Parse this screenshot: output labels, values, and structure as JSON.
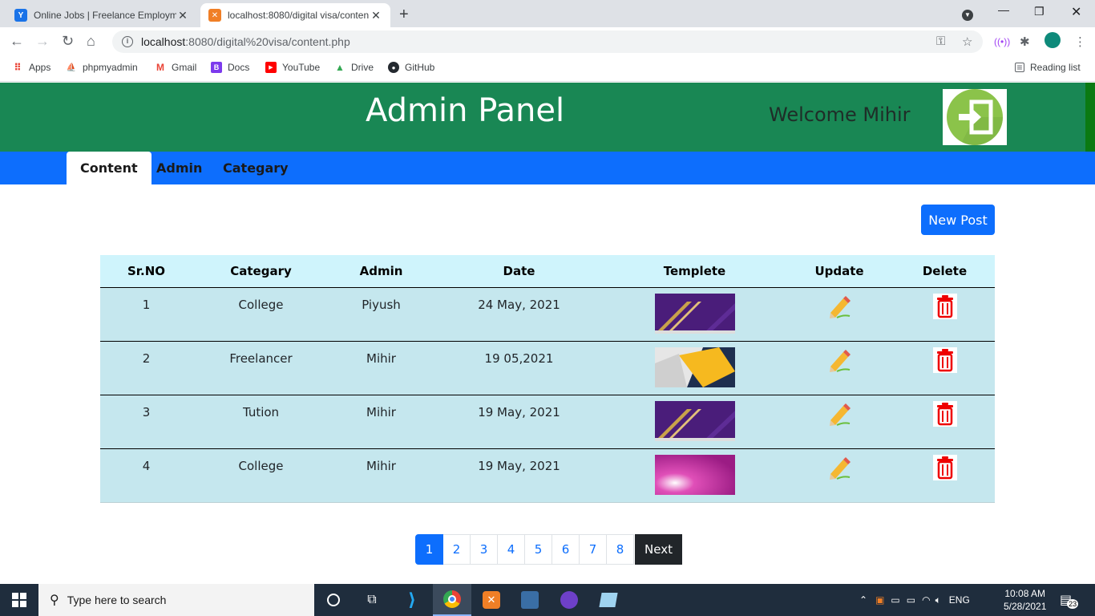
{
  "browser": {
    "tabs": [
      {
        "title": "Online Jobs | Freelance Employm",
        "active": false
      },
      {
        "title": "localhost:8080/digital visa/conten",
        "active": true
      }
    ],
    "url_host": "localhost",
    "url_path": ":8080/digital%20visa/content.php",
    "bookmarks": [
      "Apps",
      "phpmyadmin",
      "Gmail",
      "Docs",
      "YouTube",
      "Drive",
      "GitHub"
    ],
    "reading_list": "Reading list"
  },
  "header": {
    "title": "Admin Panel",
    "welcome": "Welcome Mihir",
    "logout_icon": "logout-icon"
  },
  "nav": {
    "tabs": [
      "Content",
      "Admin",
      "Categary"
    ],
    "active": "Content"
  },
  "new_post_label": "New Post",
  "table": {
    "headers": [
      "Sr.NO",
      "Categary",
      "Admin",
      "Date",
      "Templete",
      "Update",
      "Delete"
    ],
    "rows": [
      {
        "sr": "1",
        "category": "College",
        "admin": "Piyush",
        "date": "24 May, 2021",
        "thumb": "purple-gold"
      },
      {
        "sr": "2",
        "category": "Freelancer",
        "admin": "Mihir",
        "date": "19 05,2021",
        "thumb": "yellow-white"
      },
      {
        "sr": "3",
        "category": "Tution",
        "admin": "Mihir",
        "date": "19 May, 2021",
        "thumb": "purple-gold"
      },
      {
        "sr": "4",
        "category": "College",
        "admin": "Mihir",
        "date": "19 May, 2021",
        "thumb": "magenta"
      }
    ]
  },
  "pagination": {
    "pages": [
      "1",
      "2",
      "3",
      "4",
      "5",
      "6",
      "7",
      "8"
    ],
    "current": "1",
    "next_label": "Next"
  },
  "taskbar": {
    "search_placeholder": "Type here to search",
    "language": "ENG",
    "time": "10:08 AM",
    "date": "5/28/2021",
    "notifications": "23"
  }
}
